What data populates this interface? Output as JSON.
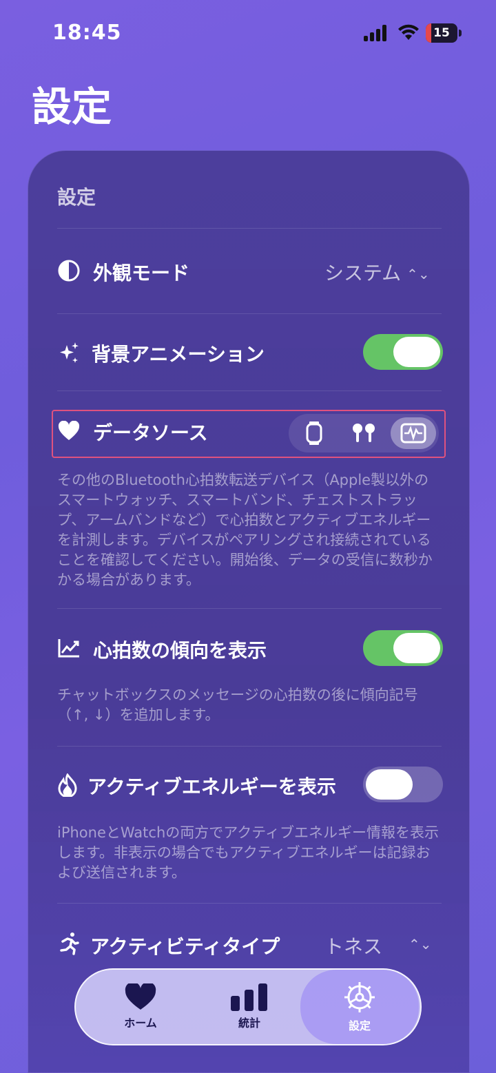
{
  "status_bar": {
    "time": "18:45",
    "battery": "15"
  },
  "page_title": "設定",
  "card": {
    "title": "設定",
    "appearance": {
      "label": "外観モード",
      "value": "システム"
    },
    "background_animation": {
      "label": "背景アニメーション",
      "enabled": true
    },
    "data_source": {
      "label": "データソース",
      "options": [
        "watch-icon",
        "airpods-icon",
        "heart-monitor-icon"
      ],
      "selected": "heart-monitor-icon",
      "description": "その他のBluetooth心拍数転送デバイス（Apple製以外のスマートウォッチ、スマートバンド、チェストストラップ、アームバンドなど）で心拍数とアクティブエネルギーを計測します。デバイスがペアリングされ接続されていることを確認してください。開始後、データの受信に数秒かかる場合があります。"
    },
    "heart_trend": {
      "label": "心拍数の傾向を表示",
      "enabled": true,
      "description": "チャットボックスのメッセージの心拍数の後に傾向記号（↑, ↓）を追加します。"
    },
    "active_energy": {
      "label": "アクティブエネルギーを表示",
      "enabled": false,
      "description": "iPhoneとWatchの両方でアクティブエネルギー情報を表示します。非表示の場合でもアクティブエネルギーは記録および送信されます。"
    },
    "activity_type": {
      "label": "アクティビティタイプ",
      "value": "トネス"
    }
  },
  "tabbar": {
    "tabs": [
      {
        "label": "ホーム",
        "icon": "heart-icon"
      },
      {
        "label": "統計",
        "icon": "bar-chart-icon"
      },
      {
        "label": "設定",
        "icon": "gear-icon"
      }
    ],
    "active": "設定"
  },
  "colors": {
    "toggle_on": "#65c466",
    "highlight": "#e0527f",
    "tab_icon": "#1b1650"
  }
}
